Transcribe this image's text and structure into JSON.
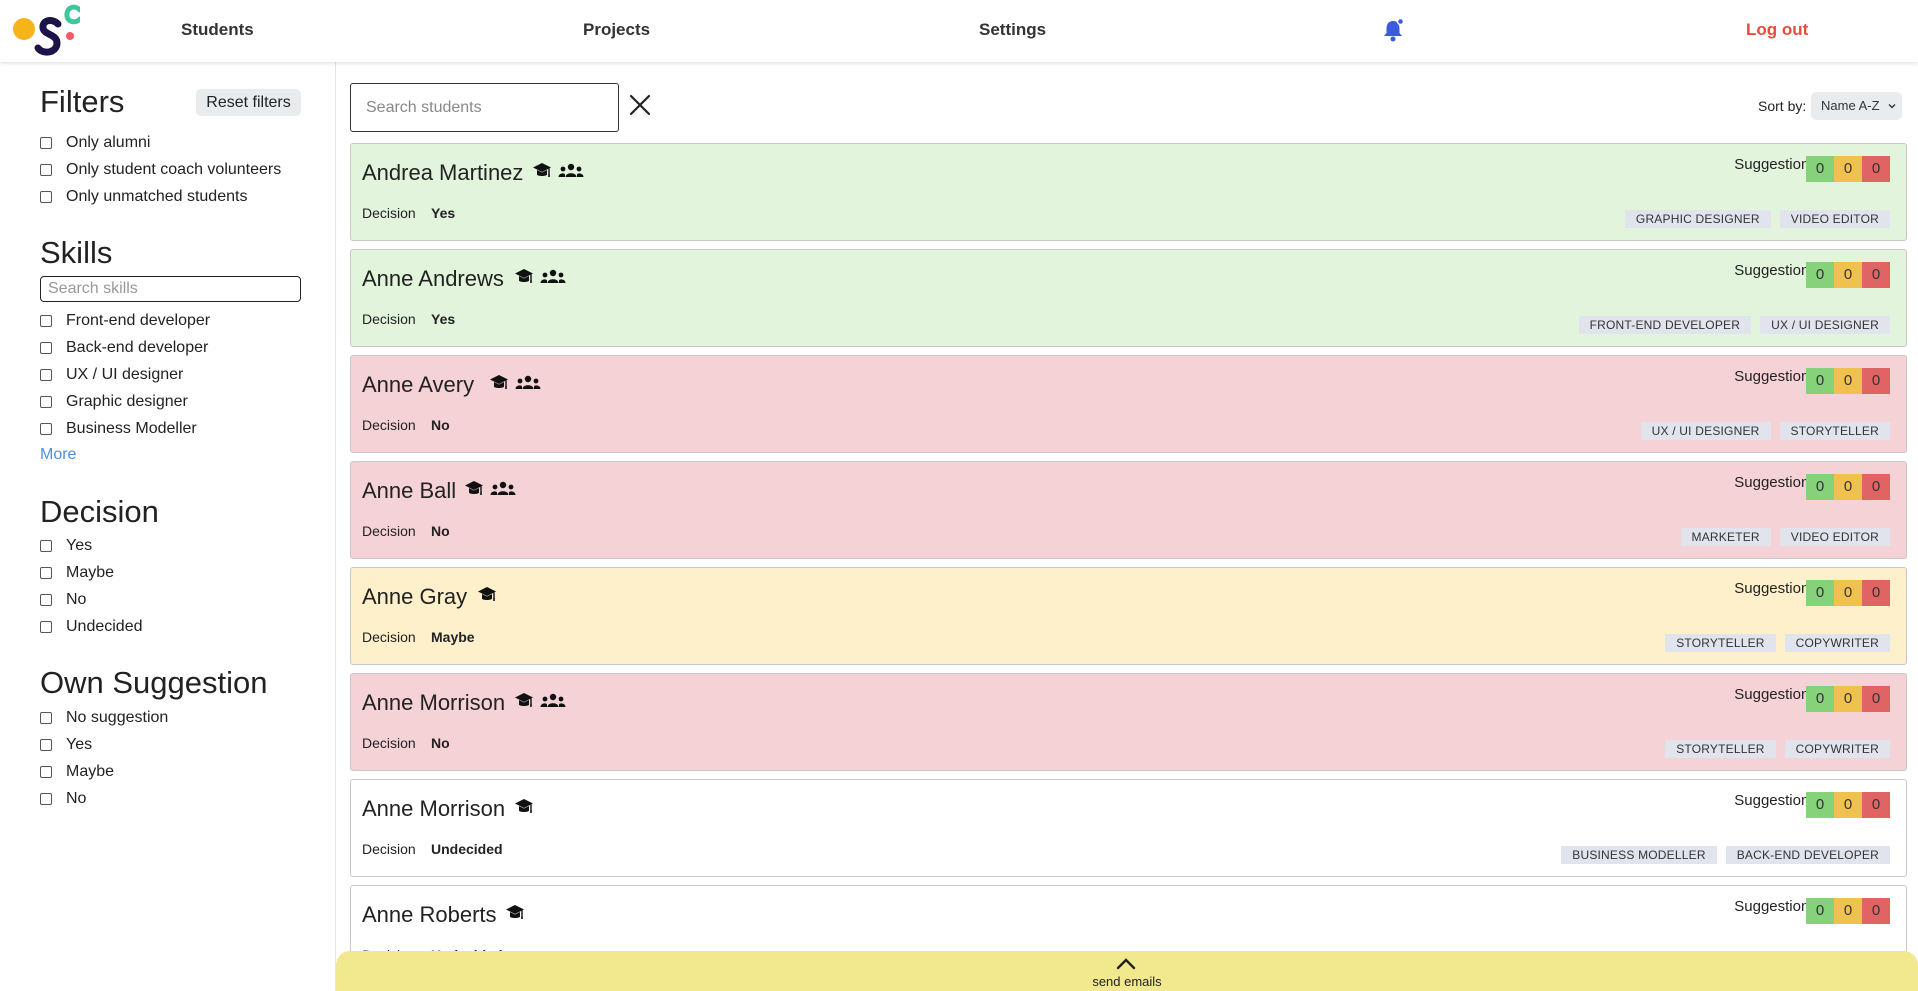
{
  "nav": {
    "students": "Students",
    "projects": "Projects",
    "settings": "Settings",
    "logout": "Log out",
    "notification_icon": "bell-icon"
  },
  "sidebar": {
    "filters_title": "Filters",
    "reset_label": "Reset filters",
    "general": [
      "Only alumni",
      "Only student coach volunteers",
      "Only unmatched students"
    ],
    "skills_title": "Skills",
    "skills_placeholder": "Search skills",
    "skills": [
      "Front-end developer",
      "Back-end developer",
      "UX / UI designer",
      "Graphic designer",
      "Business Modeller"
    ],
    "more_label": "More",
    "decision_title": "Decision",
    "decisions": [
      "Yes",
      "Maybe",
      "No",
      "Undecided"
    ],
    "own_suggestion_title": "Own Suggestion",
    "own_suggestions": [
      "No suggestion",
      "Yes",
      "Maybe",
      "No"
    ]
  },
  "main": {
    "search_placeholder": "Search students",
    "sort_label": "Sort by:",
    "sort_value": "Name A-Z",
    "decision_label": "Decision",
    "suggestions_label": "Suggestions:",
    "students": [
      {
        "name": "Andrea Martinez",
        "decision": "Yes",
        "alumni": true,
        "coach": true,
        "suggestions": [
          "0",
          "0",
          "0"
        ],
        "skills": [
          "GRAPHIC DESIGNER",
          "VIDEO EDITOR"
        ]
      },
      {
        "name": "Anne Andrews",
        "decision": "Yes",
        "alumni": true,
        "coach": true,
        "suggestions": [
          "0",
          "0",
          "0"
        ],
        "skills": [
          "FRONT-END DEVELOPER",
          "UX / UI DESIGNER"
        ]
      },
      {
        "name": "Anne Avery",
        "decision": "No",
        "alumni": true,
        "coach": true,
        "suggestions": [
          "0",
          "0",
          "0"
        ],
        "skills": [
          "UX / UI DESIGNER",
          "STORYTELLER"
        ]
      },
      {
        "name": "Anne Ball",
        "decision": "No",
        "alumni": true,
        "coach": true,
        "suggestions": [
          "0",
          "0",
          "0"
        ],
        "skills": [
          "MARKETER",
          "VIDEO EDITOR"
        ]
      },
      {
        "name": "Anne Gray",
        "decision": "Maybe",
        "alumni": true,
        "coach": false,
        "suggestions": [
          "0",
          "0",
          "0"
        ],
        "skills": [
          "STORYTELLER",
          "COPYWRITER"
        ]
      },
      {
        "name": "Anne Morrison",
        "decision": "No",
        "alumni": true,
        "coach": true,
        "suggestions": [
          "0",
          "0",
          "0"
        ],
        "skills": [
          "STORYTELLER",
          "COPYWRITER"
        ]
      },
      {
        "name": "Anne Morrison",
        "decision": "Undecided",
        "alumni": true,
        "coach": false,
        "suggestions": [
          "0",
          "0",
          "0"
        ],
        "skills": [
          "BUSINESS MODELLER",
          "BACK-END DEVELOPER"
        ]
      },
      {
        "name": "Anne Roberts",
        "decision": "Undecided",
        "alumni": true,
        "coach": false,
        "suggestions": [
          "0",
          "0",
          "0"
        ],
        "skills": []
      }
    ]
  },
  "footer": {
    "send_emails_label": "send emails"
  },
  "colors": {
    "yes": "#e2f4dc",
    "no": "#f5d2d5",
    "maybe": "#fdf0ca",
    "logout": "#e74c3c",
    "bell": "#3b5bdb",
    "bar": "#f2e88d"
  }
}
